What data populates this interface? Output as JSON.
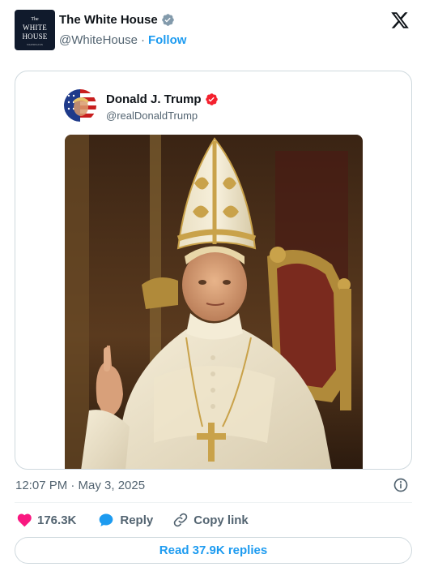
{
  "author": {
    "name": "The White House",
    "handle": "@WhiteHouse",
    "separator": "·",
    "follow_label": "Follow",
    "avatar_text": {
      "line1": "The",
      "line2": "WHITE",
      "line3": "HOUSE",
      "line4": "WASHINGTON"
    }
  },
  "quoted_post": {
    "name": "Donald J. Trump",
    "handle": "@realDonaldTrump"
  },
  "timestamp": "12:07 PM · May 3, 2025",
  "actions": {
    "likes_count": "176.3K",
    "reply_label": "Reply",
    "copy_label": "Copy link"
  },
  "read_replies_label": "Read 37.9K replies",
  "colors": {
    "accent": "#1d9bf0",
    "like": "#f91880",
    "verified_gray": "#829aab",
    "verified_red": "#f4212e"
  }
}
